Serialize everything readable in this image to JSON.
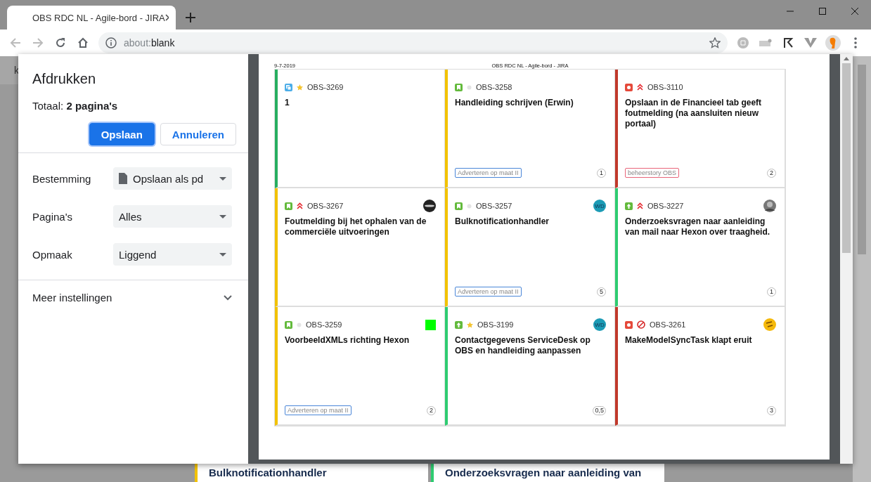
{
  "browser": {
    "tab_title": "OBS RDC NL - Agile-bord - JIRA",
    "address": {
      "scheme": "about:",
      "rest": "blank"
    }
  },
  "background_page": {
    "header_fragment": "k",
    "cards": [
      {
        "title": "Bulknotificationhandler",
        "color": "#f2c200"
      },
      {
        "title": "Onderzoeksvragen naar aanleiding van",
        "color": "#2ecc71"
      }
    ]
  },
  "print_dialog": {
    "title": "Afdrukken",
    "total": "Totaal: **2 pagina's**",
    "buttons": [
      {
        "label": "Opslaan",
        "kind": "primary"
      },
      {
        "label": "Annuleren",
        "kind": "secondary"
      }
    ],
    "settings": [
      {
        "label": "Bestemming",
        "value": "Opslaan als pd",
        "kind": "destination"
      },
      {
        "label": "Pagina's",
        "value": "Alles",
        "kind": "select"
      },
      {
        "label": "Opmaak",
        "value": "Liggend",
        "kind": "select"
      }
    ],
    "more_settings": {
      "label": "Meer instellingen",
      "expanded": false
    }
  },
  "preview": {
    "date": "9-7-2019",
    "page_title": "OBS RDC NL - Agile-bord - JIRA",
    "cards": [
      {
        "color": "#27ae60",
        "type_icon": {
          "kind": "task"
        },
        "priority_icon": {
          "kind": "star"
        },
        "key": "OBS-3269",
        "title": "1"
      },
      {
        "color": "#f2c200",
        "type_icon": {
          "kind": "story"
        },
        "priority_icon": {
          "kind": "dot"
        },
        "key": "OBS-3258",
        "title": "Handleiding schrijven (Erwin)",
        "epic": {
          "label": "Adverteren op maat II",
          "color": "#4a86d8"
        },
        "estimate": "1"
      },
      {
        "color": "#c0392b",
        "type_icon": {
          "kind": "bug"
        },
        "priority_icon": {
          "kind": "high"
        },
        "key": "OBS-3110",
        "title": "Opslaan in de Financieel tab geeft foutmelding (na aansluiten nieuw portaal)",
        "epic": {
          "label": "beheerstory OBS",
          "color": "#e8657a"
        },
        "estimate": "2"
      },
      {
        "color": "#f2c200",
        "type_icon": {
          "kind": "story"
        },
        "priority_icon": {
          "kind": "high"
        },
        "key": "OBS-3267",
        "avatar": {
          "kind": "photo-dark"
        },
        "title": "Foutmelding bij het ophalen van de commerciële uitvoeringen"
      },
      {
        "color": "#f2c200",
        "type_icon": {
          "kind": "story"
        },
        "priority_icon": {
          "kind": "dot"
        },
        "key": "OBS-3257",
        "avatar": {
          "kind": "initials",
          "initials": "WD"
        },
        "title": "Bulknotificationhandler",
        "epic": {
          "label": "Adverteren op maat II",
          "color": "#4a86d8"
        },
        "estimate": "5"
      },
      {
        "color": "#2ecc71",
        "type_icon": {
          "kind": "improvement"
        },
        "priority_icon": {
          "kind": "high"
        },
        "key": "OBS-3227",
        "avatar": {
          "kind": "photo-grey"
        },
        "title": "Onderzoeksvragen naar aanleiding van mail naar Hexon over traagheid.",
        "estimate": "1"
      },
      {
        "color": "#f2c200",
        "type_icon": {
          "kind": "story"
        },
        "priority_icon": {
          "kind": "dot"
        },
        "key": "OBS-3259",
        "avatar": {
          "kind": "square"
        },
        "title": "VoorbeeldXMLs richting Hexon",
        "epic": {
          "label": "Adverteren op maat II",
          "color": "#4a86d8"
        },
        "estimate": "2"
      },
      {
        "color": "#2ecc71",
        "type_icon": {
          "kind": "improvement"
        },
        "priority_icon": {
          "kind": "star"
        },
        "key": "OBS-3199",
        "avatar": {
          "kind": "initials",
          "initials": "WD"
        },
        "title": "Contactgegevens ServiceDesk op OBS en handleiding aanpassen",
        "estimate": "0,5"
      },
      {
        "color": "#c0392b",
        "type_icon": {
          "kind": "bug"
        },
        "priority_icon": {
          "kind": "blocker"
        },
        "key": "OBS-3261",
        "avatar": {
          "kind": "emoji"
        },
        "title": "MakeModelSyncTask klapt eruit",
        "estimate": "3"
      }
    ]
  }
}
